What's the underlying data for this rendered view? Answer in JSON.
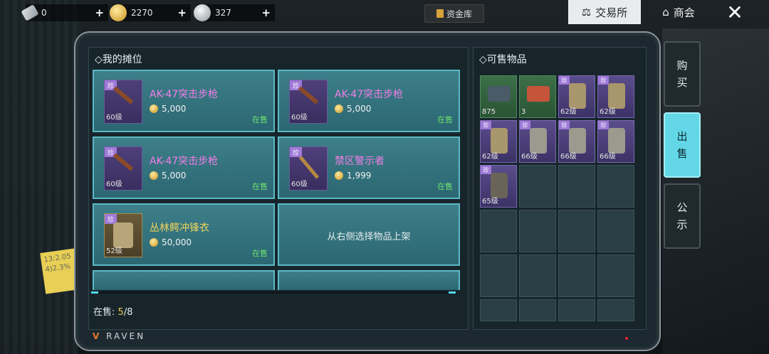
{
  "currencies": [
    {
      "name": "ticket",
      "value": "0",
      "icon": "ticket-icon"
    },
    {
      "name": "gold",
      "value": "2270",
      "icon": "gold-coin-icon"
    },
    {
      "name": "silver",
      "value": "327",
      "icon": "silver-coin-icon"
    }
  ],
  "plus_label": "+",
  "vault_label": "资金库",
  "nav": {
    "exchange": "交易所",
    "shop": "商会",
    "close": "✕"
  },
  "left_panel": {
    "title": "◇我的摊位",
    "slots": [
      {
        "name": "AK-47突击步枪",
        "price": "5,000",
        "level": "60级",
        "status": "在售",
        "badge": "珍",
        "color": "pink"
      },
      {
        "name": "AK-47突击步枪",
        "price": "5,000",
        "level": "60级",
        "status": "在售",
        "badge": "珍",
        "color": "pink"
      },
      {
        "name": "AK-47突击步枪",
        "price": "5,000",
        "level": "60级",
        "status": "在售",
        "badge": "珍",
        "color": "pink"
      },
      {
        "name": "禁区警示者",
        "price": "1,999",
        "level": "60级",
        "status": "在售",
        "badge": "珍",
        "color": "pink"
      },
      {
        "name": "丛林鳄冲锋衣",
        "price": "50,000",
        "level": "52级",
        "status": "在售",
        "badge": "珍",
        "color": "gold"
      }
    ],
    "empty_hint": "从右侧选择物品上架",
    "onsale_label": "在售:",
    "onsale_count": "5",
    "onsale_total": "/8"
  },
  "right_panel": {
    "title": "◇可售物品",
    "items": [
      {
        "kind": "green",
        "count": "875",
        "badge": ""
      },
      {
        "kind": "green",
        "count": "3",
        "badge": ""
      },
      {
        "kind": "item",
        "count": "62级",
        "badge": "珍"
      },
      {
        "kind": "item",
        "count": "62级",
        "badge": "珍"
      },
      {
        "kind": "item",
        "count": "62级",
        "badge": "珍"
      },
      {
        "kind": "item",
        "count": "66级",
        "badge": "珍"
      },
      {
        "kind": "item",
        "count": "66级",
        "badge": "珍"
      },
      {
        "kind": "item",
        "count": "66级",
        "badge": "珍"
      },
      {
        "kind": "item",
        "count": "65级",
        "badge": "珍"
      }
    ]
  },
  "side_tabs": [
    {
      "label": "购\n买",
      "active": false
    },
    {
      "label": "出\n售",
      "active": true
    },
    {
      "label": "公\n示",
      "active": false
    }
  ],
  "brand": "RAVEN",
  "note_text": "13:2.05 4)2.3%"
}
